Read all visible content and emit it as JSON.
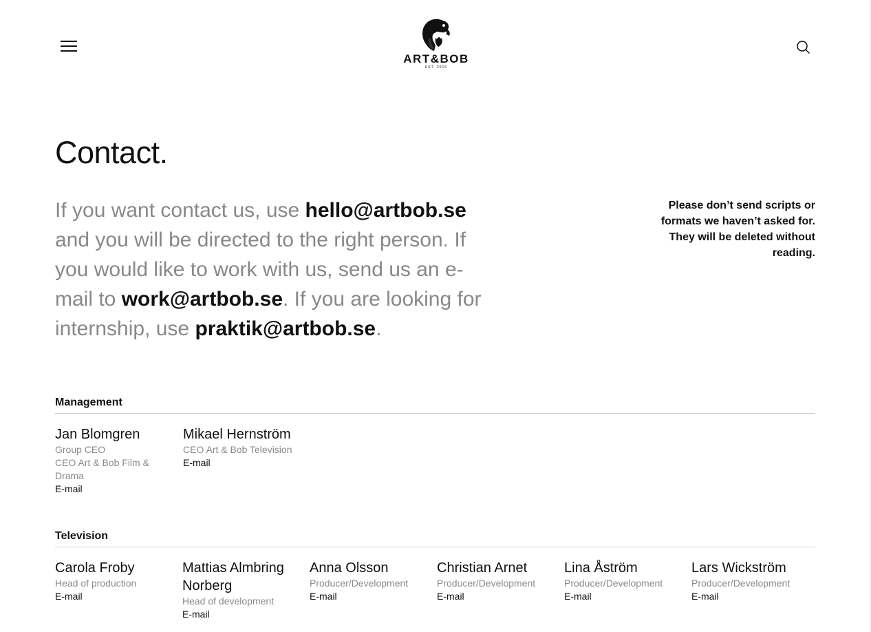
{
  "header": {
    "logo_text": "ART&BOB",
    "logo_est": "EST. 2015"
  },
  "page_title": "Contact.",
  "intro": {
    "part1": "If you want contact us, use ",
    "email_hello": "hello@artbob.se",
    "part2": " and you will be directed to the right person. If you would like to work with us, send us an e-mail to ",
    "email_work": "work@artbob.se",
    "part3": ". If you are looking for internship, use ",
    "email_praktik": "praktik@artbob.se",
    "part4": "."
  },
  "notice": "Please don’t send scripts or formats we haven’t asked for. They will be deleted without reading.",
  "sections": {
    "management": {
      "title": "Management",
      "people": [
        {
          "name": "Jan Blomgren",
          "role1": "Group CEO",
          "role2": "CEO Art & Bob Film & Drama",
          "email_label": "E-mail"
        },
        {
          "name": "Mikael Hernström",
          "role1": "CEO Art & Bob Television",
          "email_label": "E-mail"
        }
      ]
    },
    "television": {
      "title": "Television",
      "people": [
        {
          "name": "Carola Froby",
          "role1": "Head of production",
          "email_label": "E-mail"
        },
        {
          "name": "Mattias Almbring Norberg",
          "role1": "Head of development",
          "email_label": "E-mail"
        },
        {
          "name": "Anna Olsson",
          "role1": "Producer/Development",
          "email_label": "E-mail"
        },
        {
          "name": "Christian Arnet",
          "role1": "Producer/Development",
          "email_label": "E-mail"
        },
        {
          "name": "Lina Åström",
          "role1": "Producer/Development",
          "email_label": "E-mail"
        },
        {
          "name": "Lars Wickström",
          "role1": "Producer/Development",
          "email_label": "E-mail"
        }
      ]
    }
  },
  "icons": {
    "menu": "hamburger-menu-icon",
    "search": "search-icon",
    "logo": "dog-logo-icon"
  }
}
